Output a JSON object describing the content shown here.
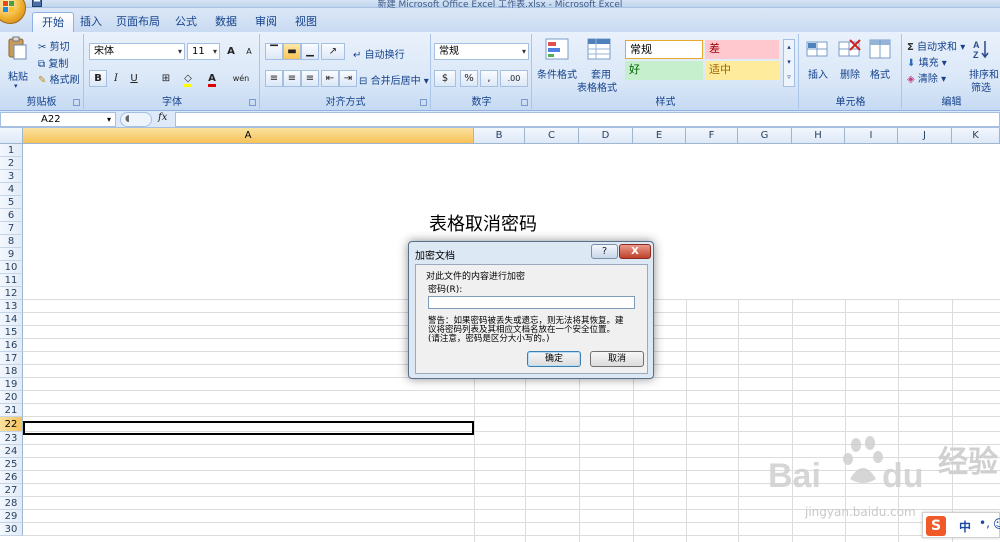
{
  "window": {
    "title": "新建 Microsoft Office Excel 工作表.xlsx - Microsoft Excel"
  },
  "tabs": [
    "开始",
    "插入",
    "页面布局",
    "公式",
    "数据",
    "审阅",
    "视图"
  ],
  "clipboard": {
    "paste": "粘贴",
    "cut": "剪切",
    "copy": "复制",
    "format_painter": "格式刷",
    "label": "剪贴板"
  },
  "font": {
    "name": "宋体",
    "size": "11",
    "label": "字体",
    "bold": "B",
    "italic": "I",
    "underline": "U",
    "grow": "A",
    "shrink": "A",
    "phonetic": "wén"
  },
  "alignment": {
    "wrap": "自动换行",
    "merge": "合并后居中",
    "label": "对齐方式"
  },
  "number": {
    "format": "常规",
    "currency": "$",
    "percent": "%",
    "comma": ",",
    "inc_dec": ".00",
    "label": "数字"
  },
  "styles": {
    "conditional": "条件格式",
    "table_top": "套用",
    "table_bottom": "表格格式",
    "normal": "常规",
    "bad": "差",
    "good": "好",
    "neutral": "适中",
    "label": "样式",
    "colors": {
      "normal_bg": "#ffffff",
      "bad_bg": "#ffc7ce",
      "bad_fg": "#9c0006",
      "good_bg": "#c6efce",
      "good_fg": "#006100",
      "neutral_bg": "#ffeb9c",
      "neutral_fg": "#9c6500"
    }
  },
  "cells": {
    "insert": "插入",
    "delete": "删除",
    "format": "格式",
    "label": "单元格"
  },
  "editing": {
    "autosum": "自动求和",
    "fill": "填充",
    "clear": "清除",
    "sort_top": "排序和",
    "sort_bottom": "筛选",
    "label": "编辑"
  },
  "formula_bar": {
    "name_box": "A22",
    "fx": "fx",
    "formula": ""
  },
  "columns": [
    "A",
    "B",
    "C",
    "D",
    "E",
    "F",
    "G",
    "H",
    "I",
    "J",
    "K"
  ],
  "rows": [
    "1",
    "2",
    "3",
    "4",
    "5",
    "6",
    "7",
    "8",
    "9",
    "10",
    "11",
    "12",
    "13",
    "14",
    "15",
    "16",
    "17",
    "18",
    "19",
    "20",
    "21",
    "22",
    "23",
    "24",
    "25",
    "26",
    "27",
    "28",
    "29",
    "30"
  ],
  "selected": {
    "column": "A",
    "row": "22"
  },
  "sheet": {
    "title_text": "表格取消密码"
  },
  "dialog": {
    "title": "加密文档",
    "help": "?",
    "close": "X",
    "heading": "对此文件的内容进行加密",
    "password_label": "密码(R):",
    "password_value": "",
    "warning_line1": "警告：如果密码被丢失或遗忘，则无法将其恢复。建",
    "warning_line2": "议将密码列表及其相应文档名放在一个安全位置。",
    "warning_line3": "(请注意，密码是区分大小写的。)",
    "ok": "确定",
    "cancel": "取消"
  },
  "watermark": {
    "brand": "Bai du 经验",
    "url": "jingyan.baidu.com"
  },
  "ime": {
    "mode": "中"
  }
}
